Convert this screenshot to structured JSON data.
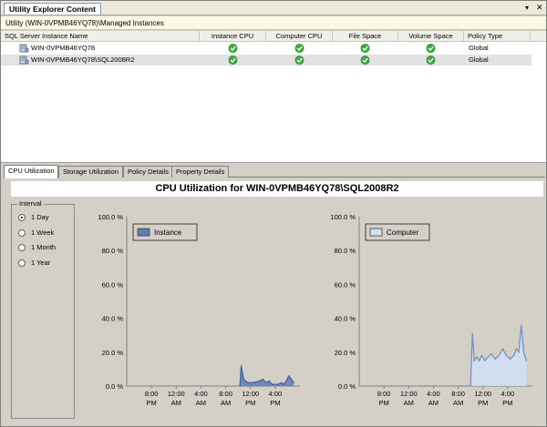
{
  "window": {
    "title": "Utility Explorer Content"
  },
  "breadcrumb": "Utility (WIN-0VPMB46YQ78)\\Managed Instances",
  "grid": {
    "columns": [
      "SQL Server Instance Name",
      "Instance CPU",
      "Computer CPU",
      "File Space",
      "Volume Space",
      "Policy Type"
    ],
    "rows": [
      {
        "name": "WIN-0VPMB46YQ78",
        "instance_cpu": "ok",
        "computer_cpu": "ok",
        "file_space": "ok",
        "volume_space": "ok",
        "policy_type": "Global",
        "selected": false
      },
      {
        "name": "WIN-0VPMB46YQ78\\SQL2008R2",
        "instance_cpu": "ok",
        "computer_cpu": "ok",
        "file_space": "ok",
        "volume_space": "ok",
        "policy_type": "Global",
        "selected": true
      }
    ]
  },
  "tabs": [
    "CPU Utilization",
    "Storage Utilization",
    "Policy Details",
    "Property Details"
  ],
  "active_tab": "CPU Utilization",
  "chart_heading": "CPU Utilization for WIN-0VPMB46YQ78\\SQL2008R2",
  "interval": {
    "label": "Interval",
    "options": [
      "1 Day",
      "1 Week",
      "1 Month",
      "1 Year"
    ],
    "selected": "1 Day"
  },
  "colors": {
    "instance_fill": "#5b7fb5",
    "instance_line": "#3a66a8",
    "computer_fill": "#cfe0f3",
    "computer_line": "#6f94c8",
    "ok_green": "#3cae3c"
  },
  "chart_data": [
    {
      "type": "area",
      "title": "",
      "legend": "Instance",
      "legend_position": "top-left",
      "y_ticks": [
        "100.0 %",
        "80.0 %",
        "60.0 %",
        "40.0 %",
        "20.0 %",
        "0.0 %"
      ],
      "ylim": [
        0,
        100
      ],
      "x_ticks": [
        [
          "8:00",
          "PM"
        ],
        [
          "12:00",
          "AM"
        ],
        [
          "4:00",
          "AM"
        ],
        [
          "8:00",
          "AM"
        ],
        [
          "12:00",
          "PM"
        ],
        [
          "4:00",
          "PM"
        ]
      ],
      "x_tick_hours": [
        20,
        24,
        28,
        32,
        36,
        40
      ],
      "xlim": [
        16,
        44
      ],
      "series": [
        {
          "name": "Instance",
          "x": [
            34.3,
            34.5,
            34.9,
            35.5,
            36.5,
            37.5,
            38.0,
            38.5,
            39.0,
            39.5,
            40.5,
            41.0,
            41.4,
            41.8,
            42.2,
            42.6,
            43.0
          ],
          "y": [
            0,
            12,
            4,
            2,
            2,
            3,
            4,
            2,
            3,
            1,
            1,
            2,
            1,
            3,
            6,
            4,
            2
          ]
        }
      ]
    },
    {
      "type": "area",
      "title": "",
      "legend": "Computer",
      "legend_position": "top-left",
      "y_ticks": [
        "100.0 %",
        "80.0 %",
        "60.0 %",
        "40.0 %",
        "20.0 %",
        "0.0 %"
      ],
      "ylim": [
        0,
        100
      ],
      "x_ticks": [
        [
          "8:00",
          "PM"
        ],
        [
          "12:00",
          "AM"
        ],
        [
          "4:00",
          "AM"
        ],
        [
          "8:00",
          "AM"
        ],
        [
          "12:00",
          "PM"
        ],
        [
          "4:00",
          "PM"
        ]
      ],
      "x_tick_hours": [
        20,
        24,
        28,
        32,
        36,
        40
      ],
      "xlim": [
        16,
        44
      ],
      "series": [
        {
          "name": "Computer",
          "x": [
            34.0,
            34.3,
            34.6,
            35.0,
            35.4,
            35.8,
            36.3,
            36.8,
            37.4,
            38.0,
            38.6,
            39.2,
            39.8,
            40.4,
            41.0,
            41.4,
            41.8,
            42.2,
            42.6,
            43.0
          ],
          "y": [
            0,
            31,
            15,
            17,
            15,
            18,
            15,
            17,
            19,
            16,
            18,
            22,
            18,
            16,
            18,
            22,
            20,
            36,
            20,
            15
          ]
        }
      ]
    }
  ]
}
